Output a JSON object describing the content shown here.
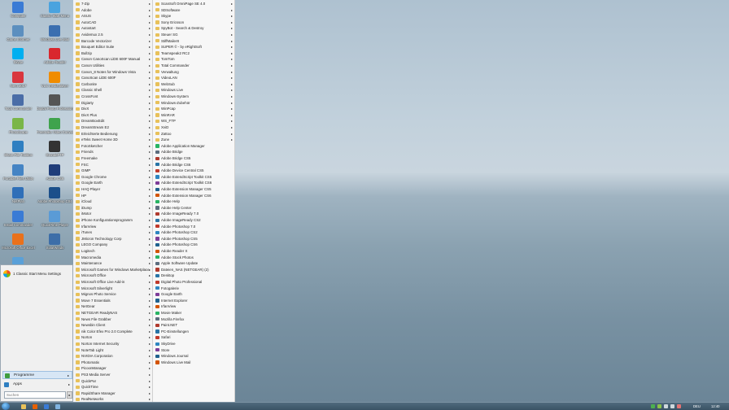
{
  "desktop": {
    "icons": [
      {
        "label": "Computer",
        "color": "#3a7bd5"
      },
      {
        "label": "Classic Start Menu",
        "color": "#4aa3df"
      },
      {
        "label": "Game Informer",
        "color": "#5c8fbf"
      },
      {
        "label": "Windows Live Mail",
        "color": "#3b6fb0"
      },
      {
        "label": "Skype",
        "color": "#00aff0"
      },
      {
        "label": "Adobe Reader",
        "color": "#d9272e"
      },
      {
        "label": "Nero 2017",
        "color": "#d9363e"
      },
      {
        "label": "VLC media player",
        "color": "#f08c00"
      },
      {
        "label": "Total Commander",
        "color": "#4a6da7"
      },
      {
        "label": "Digital Photo Professional",
        "color": "#555555"
      },
      {
        "label": "PhotoScape",
        "color": "#7ab648"
      },
      {
        "label": "Freemake Video Converter",
        "color": "#3fa34d"
      },
      {
        "label": "Share File Toolbox",
        "color": "#2f7fc1"
      },
      {
        "label": "GrandeFTP",
        "color": "#333333"
      },
      {
        "label": "Portable Files Utility",
        "color": "#4584c4"
      },
      {
        "label": "Adobe CS6",
        "color": "#1f3d7a"
      },
      {
        "label": "NetPlan",
        "color": "#2f6fb8"
      },
      {
        "label": "Adobe Photoshop CS6",
        "color": "#1b4f8a"
      },
      {
        "label": "Install Commander",
        "color": "#3a7bd5"
      },
      {
        "label": "QuickTime Player",
        "color": "#5a9bd6"
      },
      {
        "label": "Microsoft Office Excel",
        "color": "#e9711c"
      },
      {
        "label": "SolarWinds",
        "color": "#3d6ea8"
      },
      {
        "label": "",
        "color": "#5aa0d8"
      }
    ]
  },
  "programs_col1": [
    "7-Zip",
    "Adobe",
    "ASUS",
    "AutoCAD",
    "Autostart",
    "Avidemux 2.5",
    "Barcode Vectorizer",
    "Bouquet Editor Suite",
    "Bullzip",
    "Canon CanoScan LiDE 600F Manual",
    "Canon Utilities",
    "Canon_8 Notes for Windows Vista",
    "CanoScan LiDE 600F",
    "Carbonite",
    "Classic Shell",
    "CrossFont",
    "Digiarty",
    "DivX",
    "DivX Plus",
    "DreamBoxEdit",
    "DreamStream E2",
    "Erleichterte Bedienung",
    "eTeks Sweet Home 3D",
    "FotoSketcher",
    "Friends",
    "Freemake",
    "FSC",
    "GIMP",
    "Google Chrome",
    "Google Earth",
    "HAQ Player",
    "HP",
    "iCloud",
    "iDump",
    "iMotor",
    "iPhone Konfigurationsprogramm",
    "IrfanView",
    "iTunes",
    "JMicron Technology Corp",
    "LEGO Company",
    "Logitech",
    "Macromedia",
    "Maintenance",
    "Microsoft Games for Windows Marketplace",
    "Microsoft Office",
    "Microsoft Office Live Add-in",
    "Microsoft Silverlight",
    "Mignos Photo Service",
    "Move 7 Essentials",
    "NetGear",
    "NETGEAR ReadyNAS",
    "News File Grabber",
    "Newsbin Client",
    "nik Color Efex Pro 2.0 Complete",
    "Norton",
    "Norton Internet Security",
    "NoteTab Light",
    "NVIDIA Corporation",
    "Photomatix",
    "PicoonManager",
    "PS3 Media Server",
    "QuickPar",
    "QuickTime",
    "RapidShare Manager",
    "RealNetworks"
  ],
  "programs_col2": [
    "ScanSoft OmniPage SE 4.0",
    "SDSoftware",
    "Skype",
    "Sony Ericsson",
    "SpyBot - Search & Destroy",
    "Steuer SG",
    "StiffMailer8",
    "SUPER © - by eRightSoft",
    "Teamspeak2 RC2",
    "TomTom",
    "Total Commander",
    "Verwaltung",
    "VideoLAN",
    "WebSub",
    "Windows Live",
    "Windows-System",
    "Windows-Zubehör",
    "WinPcap",
    "WinRAR",
    "WS_FTP",
    "XviD",
    "Zattoo",
    "Zune",
    "Adobe Application Manager",
    "Adobe Bridge",
    "Adobe Bridge CS5",
    "Adobe Bridge CS6",
    "Adobe Device Central CS5",
    "Adobe ExtendScript Toolkit CS5",
    "Adobe ExtendScript Toolkit CS6",
    "Adobe Extension Manager CS5",
    "Adobe Extension Manager CS6",
    "Adobe Help",
    "Adobe Help Center",
    "Adobe ImageReady 7.0",
    "Adobe ImageReady CS2",
    "Adobe Photoshop 7.0",
    "Adobe Photoshop CS2",
    "Adobe Photoshop CS5",
    "Adobe Photoshop CS6",
    "Adobe Reader X",
    "Adobe Stock Photos",
    "Apple Software Update",
    "Dateien_NAS (NETGEAR) (2)",
    "Desktop",
    "Digital Photo Professional",
    "Fotogalerie",
    "Google Earth",
    "Internet Explorer",
    "IrfanView",
    "Movie Maker",
    "Mozilla Firefox",
    "Paint.NET",
    "PC-Einstellungen",
    "Safari",
    "SkyDrive",
    "Store",
    "Windows Journal",
    "Windows Live Mail"
  ],
  "programs_col2_folder_count": 23,
  "start_menu": {
    "top_item": "1 Classic Start Menu Settings",
    "programs_label": "Programme",
    "apps_label": "Apps",
    "search_placeholder": "Suchen",
    "programs_color": "#3f9d3f",
    "apps_color": "#2f7fc1"
  },
  "taskbar": {
    "language": "DEU",
    "time": "12:40"
  },
  "colors": {
    "folder": "#e8c15a",
    "accent": "#3b6fb0"
  }
}
